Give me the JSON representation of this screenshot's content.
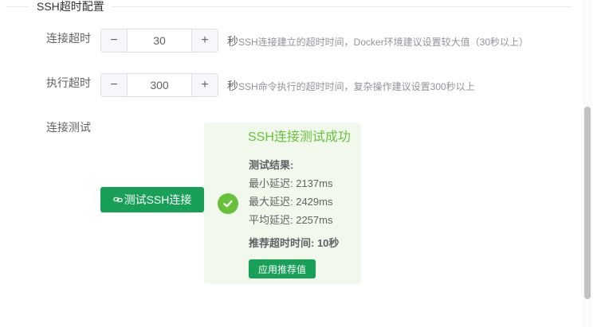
{
  "section": {
    "title": "SSH超时配置"
  },
  "connect_timeout": {
    "label": "连接超时",
    "value": "30",
    "unit": "秒",
    "description": "SSH连接建立的超时时间，Docker环境建议设置较大值（30秒以上）"
  },
  "exec_timeout": {
    "label": "执行超时",
    "value": "300",
    "unit": "秒",
    "description": "SSH命令执行的超时时间，复杂操作建议设置300秒以上"
  },
  "stepper": {
    "decrease": "−",
    "increase": "+"
  },
  "connection_test": {
    "label": "连接测试",
    "button_label": "测试SSH连接"
  },
  "result": {
    "title": "SSH连接测试成功",
    "heading": "测试结果:",
    "min_latency": "最小延迟: 2137ms",
    "max_latency": "最大延迟: 2429ms",
    "avg_latency": "平均延迟: 2257ms",
    "recommended": "推荐超时时间: 10秒",
    "apply_button": "应用推荐值"
  },
  "colors": {
    "primary": "#18a058",
    "success": "#67c23a",
    "success_bg": "#f0f9eb"
  },
  "icons": [
    "chain-link-icon",
    "check-circle-icon"
  ]
}
